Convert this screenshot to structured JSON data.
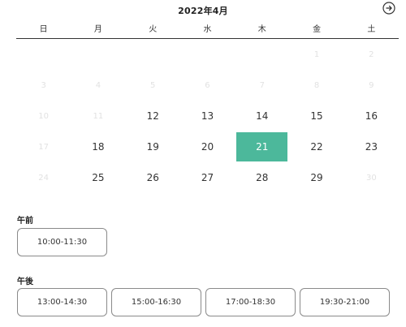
{
  "calendar": {
    "month_title": "2022年4月",
    "next_icon": "arrow-right-circle-icon",
    "weekdays": [
      "日",
      "月",
      "火",
      "水",
      "木",
      "金",
      "土"
    ],
    "weeks": [
      [
        {
          "day": "",
          "state": "empty"
        },
        {
          "day": "",
          "state": "empty"
        },
        {
          "day": "",
          "state": "empty"
        },
        {
          "day": "",
          "state": "empty"
        },
        {
          "day": "",
          "state": "empty"
        },
        {
          "day": "1",
          "state": "disabled"
        },
        {
          "day": "2",
          "state": "disabled"
        }
      ],
      [
        {
          "day": "3",
          "state": "disabled"
        },
        {
          "day": "4",
          "state": "disabled"
        },
        {
          "day": "5",
          "state": "disabled"
        },
        {
          "day": "6",
          "state": "disabled"
        },
        {
          "day": "7",
          "state": "disabled"
        },
        {
          "day": "8",
          "state": "disabled"
        },
        {
          "day": "9",
          "state": "disabled"
        }
      ],
      [
        {
          "day": "10",
          "state": "disabled"
        },
        {
          "day": "11",
          "state": "disabled"
        },
        {
          "day": "12",
          "state": "available"
        },
        {
          "day": "13",
          "state": "available"
        },
        {
          "day": "14",
          "state": "available"
        },
        {
          "day": "15",
          "state": "available"
        },
        {
          "day": "16",
          "state": "available"
        }
      ],
      [
        {
          "day": "17",
          "state": "disabled"
        },
        {
          "day": "18",
          "state": "available"
        },
        {
          "day": "19",
          "state": "available"
        },
        {
          "day": "20",
          "state": "available"
        },
        {
          "day": "21",
          "state": "selected"
        },
        {
          "day": "22",
          "state": "available"
        },
        {
          "day": "23",
          "state": "available"
        }
      ],
      [
        {
          "day": "24",
          "state": "disabled"
        },
        {
          "day": "25",
          "state": "available"
        },
        {
          "day": "26",
          "state": "available"
        },
        {
          "day": "27",
          "state": "available"
        },
        {
          "day": "28",
          "state": "available"
        },
        {
          "day": "29",
          "state": "available"
        },
        {
          "day": "30",
          "state": "disabled"
        }
      ]
    ],
    "selected_color": "#4cb89b"
  },
  "morning": {
    "label": "午前",
    "slots": [
      "10:00-11:30"
    ]
  },
  "afternoon": {
    "label": "午後",
    "slots": [
      "13:00-14:30",
      "15:00-16:30",
      "17:00-18:30",
      "19:30-21:00"
    ]
  }
}
